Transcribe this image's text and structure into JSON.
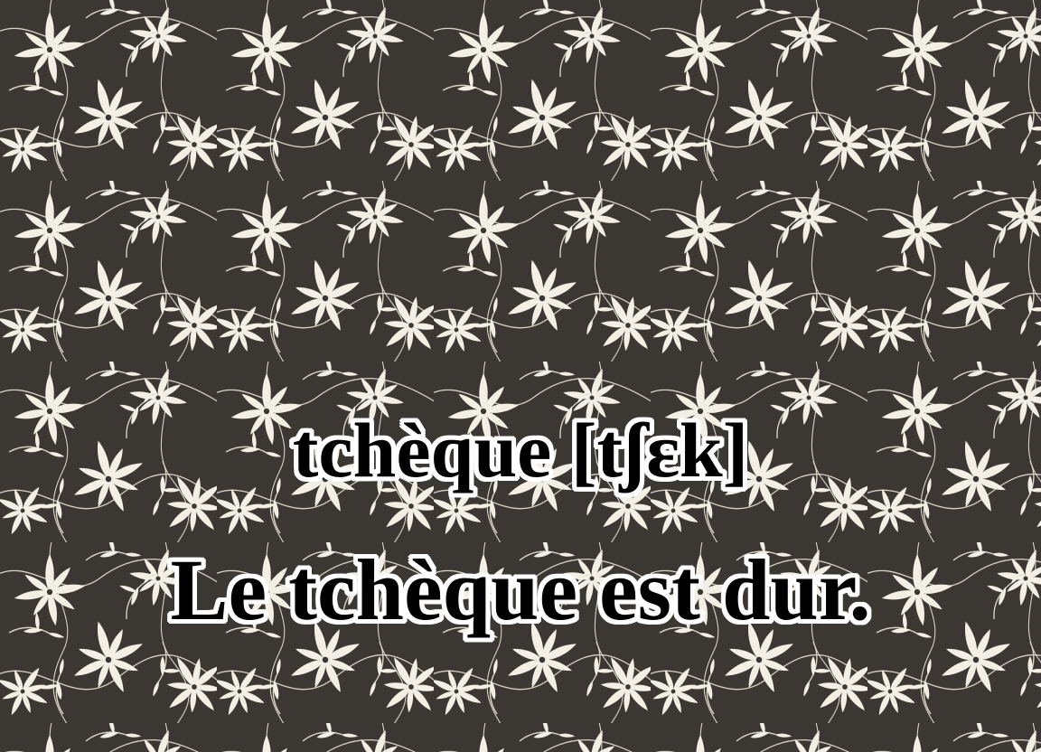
{
  "background": {
    "base_color": "#3b3733",
    "leaf_color": "#f3efe4",
    "vine_color": "#d8d2c4",
    "motif": "white-leaf-floral-pattern"
  },
  "caption": {
    "word_line": "tchèque [tʃɛk]",
    "sentence_line": "Le tchèque est dur.",
    "text_color": "#000000",
    "outline_color": "#ffffff"
  }
}
